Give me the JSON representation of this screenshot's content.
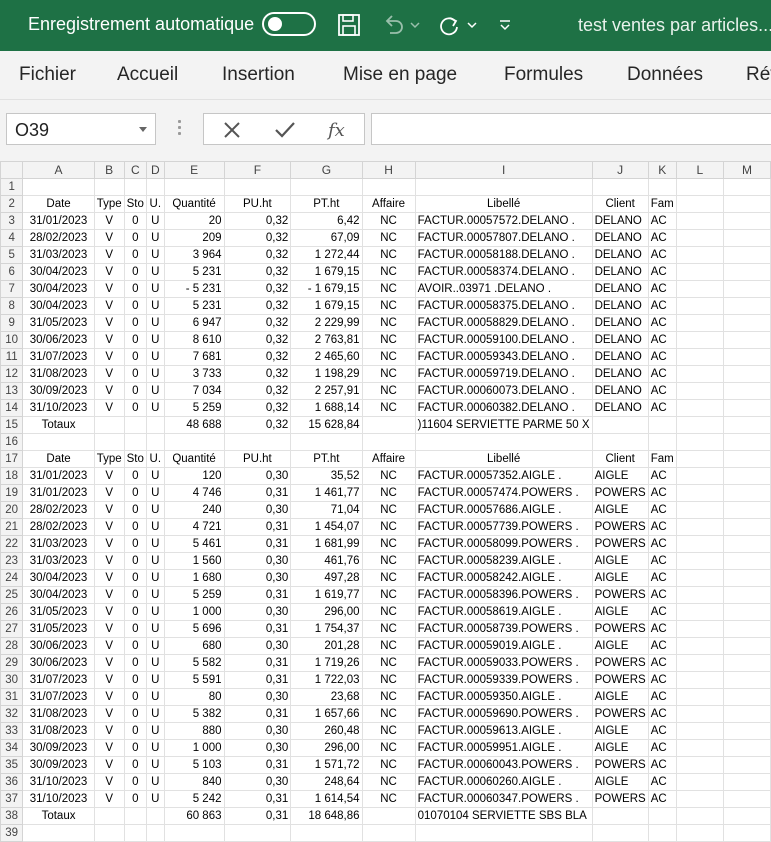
{
  "titlebar": {
    "autosave_label": "Enregistrement automatique",
    "doc_title": "test ventes par articles..."
  },
  "ribbon": {
    "tabs": [
      "Fichier",
      "Accueil",
      "Insertion",
      "Mise en page",
      "Formules",
      "Données",
      "Rév"
    ]
  },
  "formula_bar": {
    "name_box": "O39",
    "fx_label": "fx",
    "value": ""
  },
  "grid": {
    "columns": [
      "A",
      "B",
      "C",
      "D",
      "E",
      "F",
      "G",
      "H",
      "I",
      "J",
      "K",
      "L",
      "M"
    ],
    "header_labels": [
      "Date",
      "Type",
      "Sto",
      "U.",
      "Quantité",
      "PU.ht",
      "PT.ht",
      "Affaire",
      "Libellé",
      "Client",
      "Fam"
    ],
    "section1": [
      [
        "31/01/2023",
        "V",
        "0",
        "U",
        "20",
        "0,32",
        "6,42",
        "NC",
        "FACTUR.00057572.DELANO .",
        "DELANO",
        "AC"
      ],
      [
        "28/02/2023",
        "V",
        "0",
        "U",
        "209",
        "0,32",
        "67,09",
        "NC",
        "FACTUR.00057807.DELANO .",
        "DELANO",
        "AC"
      ],
      [
        "31/03/2023",
        "V",
        "0",
        "U",
        "3 964",
        "0,32",
        "1 272,44",
        "NC",
        "FACTUR.00058188.DELANO .",
        "DELANO",
        "AC"
      ],
      [
        "30/04/2023",
        "V",
        "0",
        "U",
        "5 231",
        "0,32",
        "1 679,15",
        "NC",
        "FACTUR.00058374.DELANO .",
        "DELANO",
        "AC"
      ],
      [
        "30/04/2023",
        "V",
        "0",
        "U",
        "- 5 231",
        "0,32",
        "- 1 679,15",
        "NC",
        "AVOIR..03971 .DELANO .",
        "DELANO",
        "AC"
      ],
      [
        "30/04/2023",
        "V",
        "0",
        "U",
        "5 231",
        "0,32",
        "1 679,15",
        "NC",
        "FACTUR.00058375.DELANO .",
        "DELANO",
        "AC"
      ],
      [
        "31/05/2023",
        "V",
        "0",
        "U",
        "6 947",
        "0,32",
        "2 229,99",
        "NC",
        "FACTUR.00058829.DELANO .",
        "DELANO",
        "AC"
      ],
      [
        "30/06/2023",
        "V",
        "0",
        "U",
        "8 610",
        "0,32",
        "2 763,81",
        "NC",
        "FACTUR.00059100.DELANO .",
        "DELANO",
        "AC"
      ],
      [
        "31/07/2023",
        "V",
        "0",
        "U",
        "7 681",
        "0,32",
        "2 465,60",
        "NC",
        "FACTUR.00059343.DELANO .",
        "DELANO",
        "AC"
      ],
      [
        "31/08/2023",
        "V",
        "0",
        "U",
        "3 733",
        "0,32",
        "1 198,29",
        "NC",
        "FACTUR.00059719.DELANO .",
        "DELANO",
        "AC"
      ],
      [
        "30/09/2023",
        "V",
        "0",
        "U",
        "7 034",
        "0,32",
        "2 257,91",
        "NC",
        "FACTUR.00060073.DELANO .",
        "DELANO",
        "AC"
      ],
      [
        "31/10/2023",
        "V",
        "0",
        "U",
        "5 259",
        "0,32",
        "1 688,14",
        "NC",
        "FACTUR.00060382.DELANO .",
        "DELANO",
        "AC"
      ]
    ],
    "totals1": {
      "label": "Totaux",
      "qty": "48 688",
      "pu": "0,32",
      "pt": "15 628,84",
      "libelle": ")11604 SERVIETTE PARME 50 X"
    },
    "section2": [
      [
        "31/01/2023",
        "V",
        "0",
        "U",
        "120",
        "0,30",
        "35,52",
        "NC",
        "FACTUR.00057352.AIGLE .",
        "AIGLE",
        "AC"
      ],
      [
        "31/01/2023",
        "V",
        "0",
        "U",
        "4 746",
        "0,31",
        "1 461,77",
        "NC",
        "FACTUR.00057474.POWERS .",
        "POWERS",
        "AC"
      ],
      [
        "28/02/2023",
        "V",
        "0",
        "U",
        "240",
        "0,30",
        "71,04",
        "NC",
        "FACTUR.00057686.AIGLE .",
        "AIGLE",
        "AC"
      ],
      [
        "28/02/2023",
        "V",
        "0",
        "U",
        "4 721",
        "0,31",
        "1 454,07",
        "NC",
        "FACTUR.00057739.POWERS .",
        "POWERS",
        "AC"
      ],
      [
        "31/03/2023",
        "V",
        "0",
        "U",
        "5 461",
        "0,31",
        "1 681,99",
        "NC",
        "FACTUR.00058099.POWERS .",
        "POWERS",
        "AC"
      ],
      [
        "31/03/2023",
        "V",
        "0",
        "U",
        "1 560",
        "0,30",
        "461,76",
        "NC",
        "FACTUR.00058239.AIGLE .",
        "AIGLE",
        "AC"
      ],
      [
        "30/04/2023",
        "V",
        "0",
        "U",
        "1 680",
        "0,30",
        "497,28",
        "NC",
        "FACTUR.00058242.AIGLE .",
        "AIGLE",
        "AC"
      ],
      [
        "30/04/2023",
        "V",
        "0",
        "U",
        "5 259",
        "0,31",
        "1 619,77",
        "NC",
        "FACTUR.00058396.POWERS .",
        "POWERS",
        "AC"
      ],
      [
        "31/05/2023",
        "V",
        "0",
        "U",
        "1 000",
        "0,30",
        "296,00",
        "NC",
        "FACTUR.00058619.AIGLE .",
        "AIGLE",
        "AC"
      ],
      [
        "31/05/2023",
        "V",
        "0",
        "U",
        "5 696",
        "0,31",
        "1 754,37",
        "NC",
        "FACTUR.00058739.POWERS .",
        "POWERS",
        "AC"
      ],
      [
        "30/06/2023",
        "V",
        "0",
        "U",
        "680",
        "0,30",
        "201,28",
        "NC",
        "FACTUR.00059019.AIGLE .",
        "AIGLE",
        "AC"
      ],
      [
        "30/06/2023",
        "V",
        "0",
        "U",
        "5 582",
        "0,31",
        "1 719,26",
        "NC",
        "FACTUR.00059033.POWERS .",
        "POWERS",
        "AC"
      ],
      [
        "31/07/2023",
        "V",
        "0",
        "U",
        "5 591",
        "0,31",
        "1 722,03",
        "NC",
        "FACTUR.00059339.POWERS .",
        "POWERS",
        "AC"
      ],
      [
        "31/07/2023",
        "V",
        "0",
        "U",
        "80",
        "0,30",
        "23,68",
        "NC",
        "FACTUR.00059350.AIGLE .",
        "AIGLE",
        "AC"
      ],
      [
        "31/08/2023",
        "V",
        "0",
        "U",
        "5 382",
        "0,31",
        "1 657,66",
        "NC",
        "FACTUR.00059690.POWERS .",
        "POWERS",
        "AC"
      ],
      [
        "31/08/2023",
        "V",
        "0",
        "U",
        "880",
        "0,30",
        "260,48",
        "NC",
        "FACTUR.00059613.AIGLE .",
        "AIGLE",
        "AC"
      ],
      [
        "30/09/2023",
        "V",
        "0",
        "U",
        "1 000",
        "0,30",
        "296,00",
        "NC",
        "FACTUR.00059951.AIGLE .",
        "AIGLE",
        "AC"
      ],
      [
        "30/09/2023",
        "V",
        "0",
        "U",
        "5 103",
        "0,31",
        "1 571,72",
        "NC",
        "FACTUR.00060043.POWERS .",
        "POWERS",
        "AC"
      ],
      [
        "31/10/2023",
        "V",
        "0",
        "U",
        "840",
        "0,30",
        "248,64",
        "NC",
        "FACTUR.00060260.AIGLE .",
        "AIGLE",
        "AC"
      ],
      [
        "31/10/2023",
        "V",
        "0",
        "U",
        "5 242",
        "0,31",
        "1 614,54",
        "NC",
        "FACTUR.00060347.POWERS .",
        "POWERS",
        "AC"
      ]
    ],
    "totals2": {
      "label": "Totaux",
      "qty": "60 863",
      "pu": "0,31",
      "pt": "18 648,86",
      "libelle": "01070104 SERVIETTE SBS BLA"
    }
  }
}
